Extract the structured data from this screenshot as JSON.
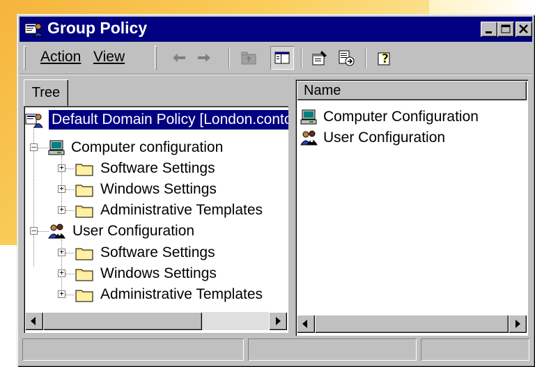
{
  "window": {
    "title": "Group Policy",
    "title_icon": "group-policy-icon",
    "controls": [
      "minimize-icon",
      "maximize-icon",
      "close-icon"
    ]
  },
  "menu": {
    "action_label": "Action",
    "view_label": "View"
  },
  "toolbar": {
    "icons": [
      "back-arrow-icon",
      "forward-arrow-icon",
      "up-folder-icon",
      "show-hide-tree-icon",
      "properties-icon",
      "export-list-icon",
      "help-icon"
    ]
  },
  "tree": {
    "tab_label": "Tree",
    "root_label": "Default Domain Policy [London.conto",
    "items": [
      {
        "label": "Computer configuration",
        "icon": "computer-icon"
      },
      {
        "label": "Software Settings",
        "icon": "folder-icon"
      },
      {
        "label": "Windows Settings",
        "icon": "folder-icon"
      },
      {
        "label": "Administrative Templates",
        "icon": "folder-icon"
      },
      {
        "label": "User Configuration",
        "icon": "users-icon"
      },
      {
        "label": "Software Settings",
        "icon": "folder-icon"
      },
      {
        "label": "Windows Settings",
        "icon": "folder-icon"
      },
      {
        "label": "Administrative Templates",
        "icon": "folder-icon"
      }
    ]
  },
  "list": {
    "column_name": "Name",
    "items": [
      {
        "label": "Computer Configuration",
        "icon": "computer-icon"
      },
      {
        "label": "User Configuration",
        "icon": "users-icon"
      }
    ]
  },
  "colors": {
    "title_bar": "#000080",
    "face": "#c0c0c0",
    "selection": "#000080",
    "folder": "#ffe680"
  }
}
